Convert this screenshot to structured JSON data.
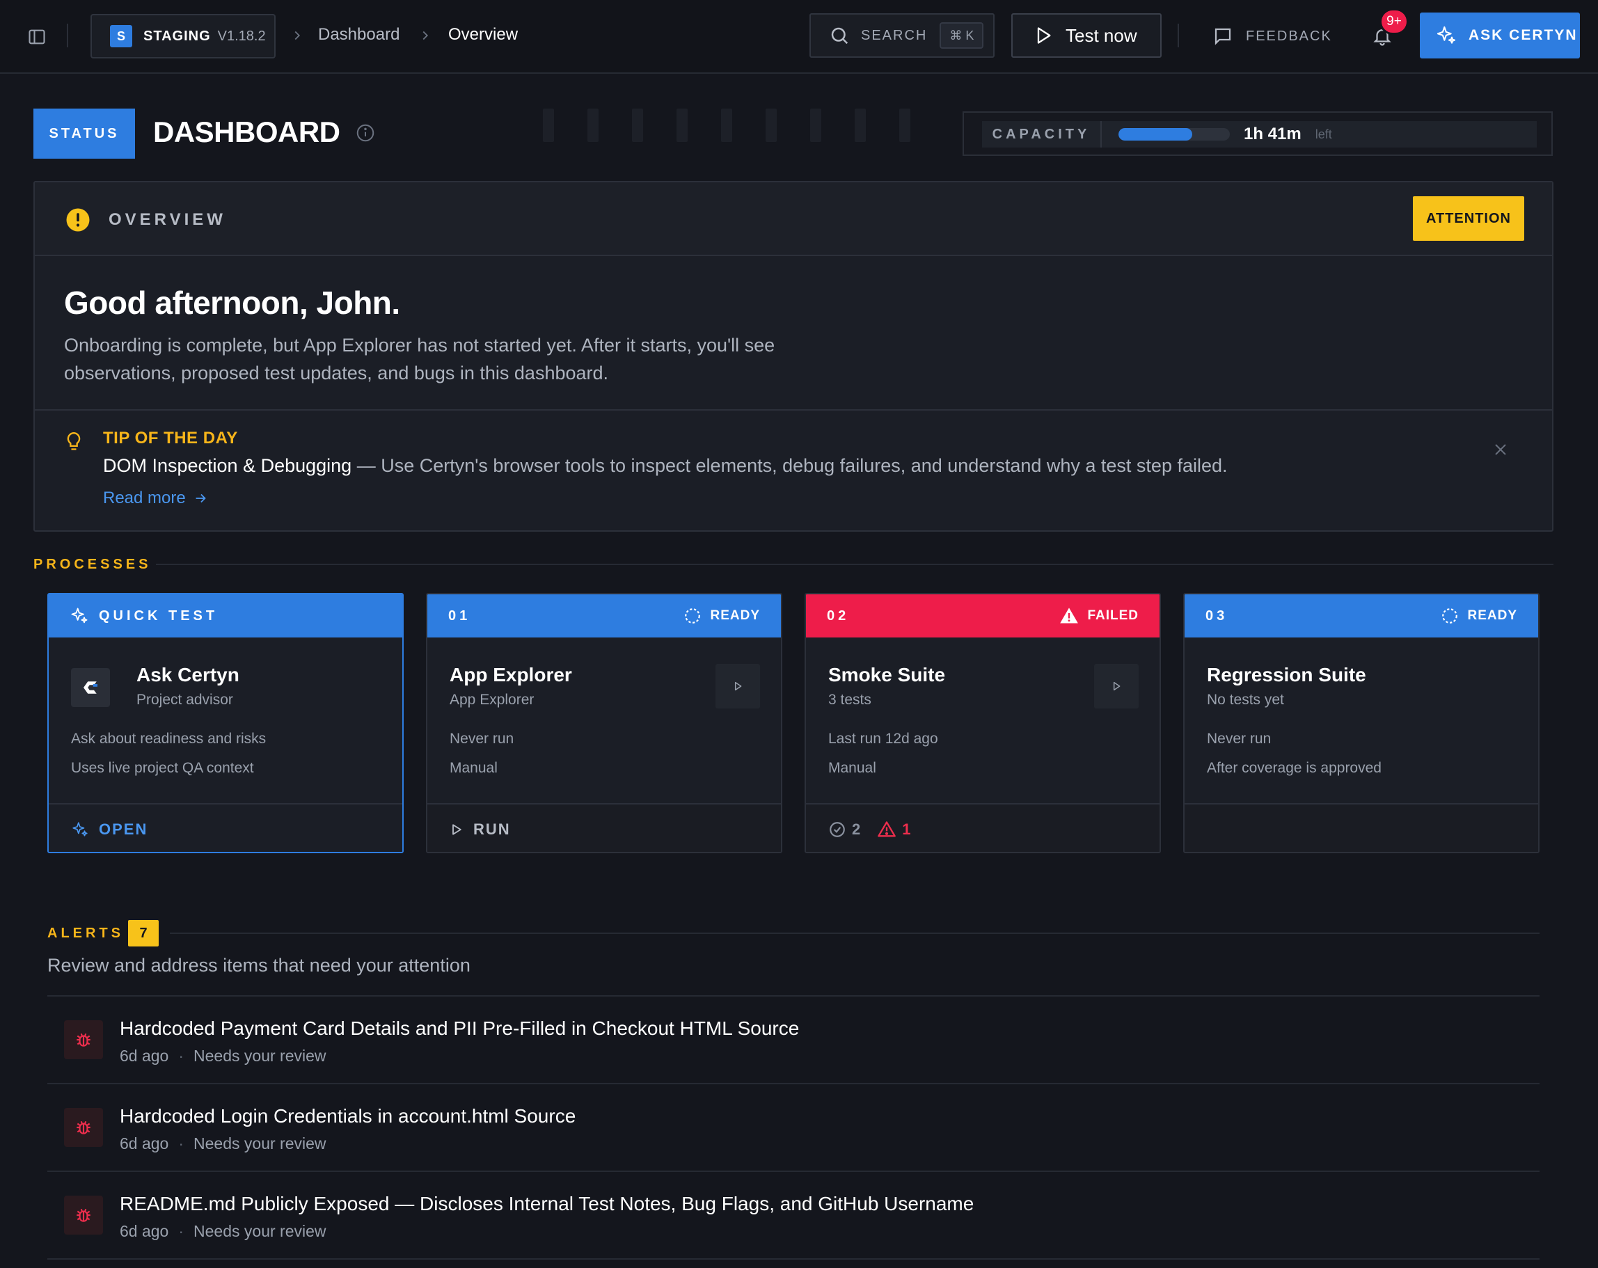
{
  "topbar": {
    "env_badge": "S",
    "env_name": "STAGING",
    "env_version": "V1.18.2",
    "breadcrumb": [
      "Dashboard",
      "Overview"
    ],
    "search_label": "SEARCH",
    "search_shortcut": "⌘ K",
    "test_now": "Test now",
    "feedback": "FEEDBACK",
    "notifications_count": "9+",
    "ask_button": "ASK CERTYN"
  },
  "header": {
    "status_chip": "STATUS",
    "title": "DASHBOARD",
    "capacity_label": "CAPACITY",
    "capacity_progress": 0.66,
    "capacity_time": "1h 41m",
    "capacity_suffix": "left"
  },
  "overview": {
    "title": "OVERVIEW",
    "badge": "ATTENTION",
    "greeting": "Good afternoon, John.",
    "body": "Onboarding is complete, but App Explorer has not started yet. After it starts, you'll see observations, proposed test updates, and bugs in this dashboard.",
    "tip_title": "TIP OF THE DAY",
    "tip_heading": "DOM Inspection & Debugging",
    "tip_text": " — Use Certyn's browser tools to inspect elements, debug failures, and understand why a test step failed.",
    "tip_link": "Read more"
  },
  "processes": {
    "label": "PROCESSES",
    "quick_test": {
      "header": "QUICK TEST",
      "name": "Ask Certyn",
      "subtitle": "Project advisor",
      "line1": "Ask about readiness and risks",
      "line2": "Uses live project QA context",
      "action": "OPEN"
    },
    "cards": [
      {
        "num": "01",
        "status": "READY",
        "name": "App Explorer",
        "subtitle": "App Explorer",
        "line1": "Never run",
        "line2": "Manual",
        "action": "RUN"
      },
      {
        "num": "02",
        "status": "FAILED",
        "name": "Smoke Suite",
        "subtitle": "3 tests",
        "line1": "Last run 12d ago",
        "line2": "Manual",
        "passed": "2",
        "failed": "1"
      },
      {
        "num": "03",
        "status": "READY",
        "name": "Regression Suite",
        "subtitle": "No tests yet",
        "line1": "Never run",
        "line2": "After coverage is approved"
      }
    ]
  },
  "alerts": {
    "label": "ALERTS",
    "count": "7",
    "subtitle": "Review and address items that need your attention",
    "items": [
      {
        "title": "Hardcoded Payment Card Details and PII Pre-Filled in Checkout HTML Source",
        "age": "6d ago",
        "status": "Needs your review"
      },
      {
        "title": "Hardcoded Login Credentials in account.html Source",
        "age": "6d ago",
        "status": "Needs your review"
      },
      {
        "title": "README.md Publicly Exposed — Discloses Internal Test Notes, Bug Flags, and GitHub Username",
        "age": "6d ago",
        "status": "Needs your review"
      }
    ]
  },
  "colors": {
    "accent": "#2e7de0",
    "warning": "#f7c21a",
    "danger": "#ee1d4a",
    "background": "#14161d"
  }
}
